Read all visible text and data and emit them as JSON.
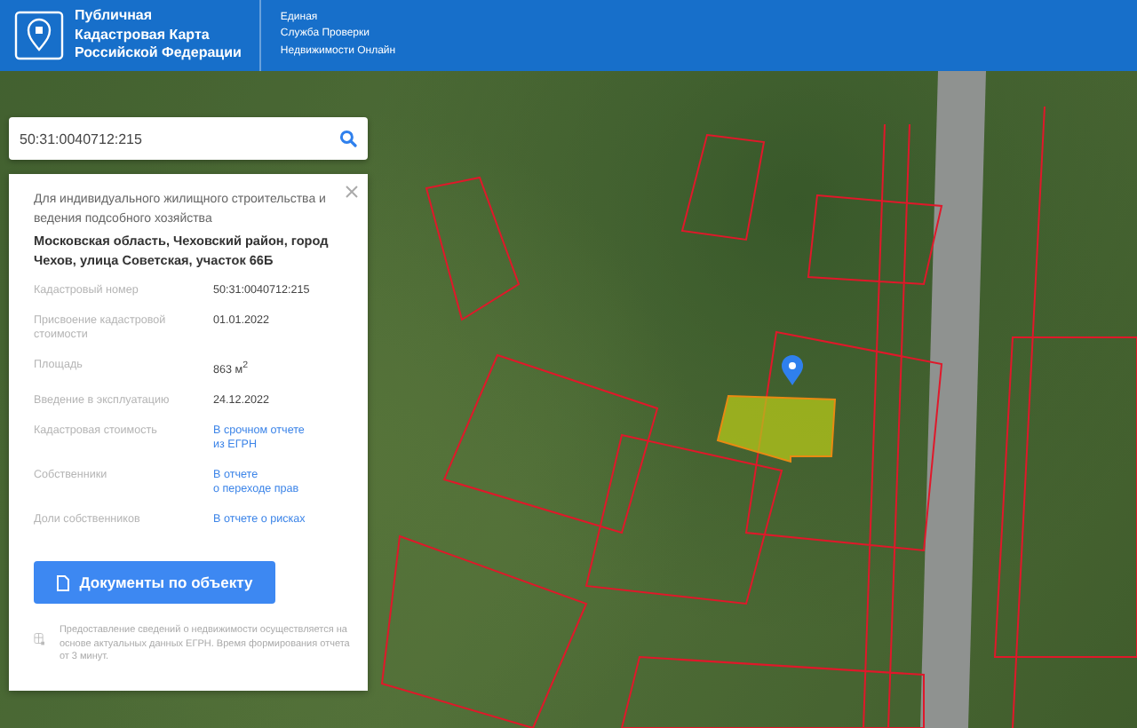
{
  "header": {
    "title_lines": [
      "Публичная",
      "Кадастровая Карта",
      "Российской Федерации"
    ],
    "subtitle_lines": [
      "Единая",
      "Служба Проверки",
      "Недвижимости Онлайн"
    ]
  },
  "search": {
    "value": "50:31:0040712:215"
  },
  "card": {
    "purpose": "Для индивидуального жилищного строительства и ведения подсобного хозяйства",
    "address": "Московская область, Чеховский район, город Чехов, улица Советская, участок 66Б",
    "fields": [
      {
        "label": "Кадастровый номер",
        "kind": "text",
        "lines": [
          "50:31:0040712:215"
        ]
      },
      {
        "label": "Присвоение кадастровой стоимости",
        "kind": "text",
        "lines": [
          "01.01.2022"
        ]
      },
      {
        "label": "Площадь",
        "kind": "text",
        "lines": [
          "863 м$^{2}$"
        ]
      },
      {
        "label": "Введение в эксплуатацию",
        "kind": "text",
        "lines": [
          "24.12.2022"
        ]
      },
      {
        "label": "Кадастровая стоимость",
        "kind": "link",
        "lines": [
          "В срочном отчете",
          "из ЕГРН"
        ]
      },
      {
        "label": "Собственники",
        "kind": "link",
        "lines": [
          "В отчете",
          "о переходе прав"
        ]
      },
      {
        "label": "Доли собственников",
        "kind": "link",
        "lines": [
          "В отчете о рисках"
        ]
      }
    ],
    "button": "Документы по объекту",
    "note": "Предоставление сведений о недвижимости осуществляется на основе актуальных данных ЕГРН. Время формирования отчета от 3 минут."
  }
}
